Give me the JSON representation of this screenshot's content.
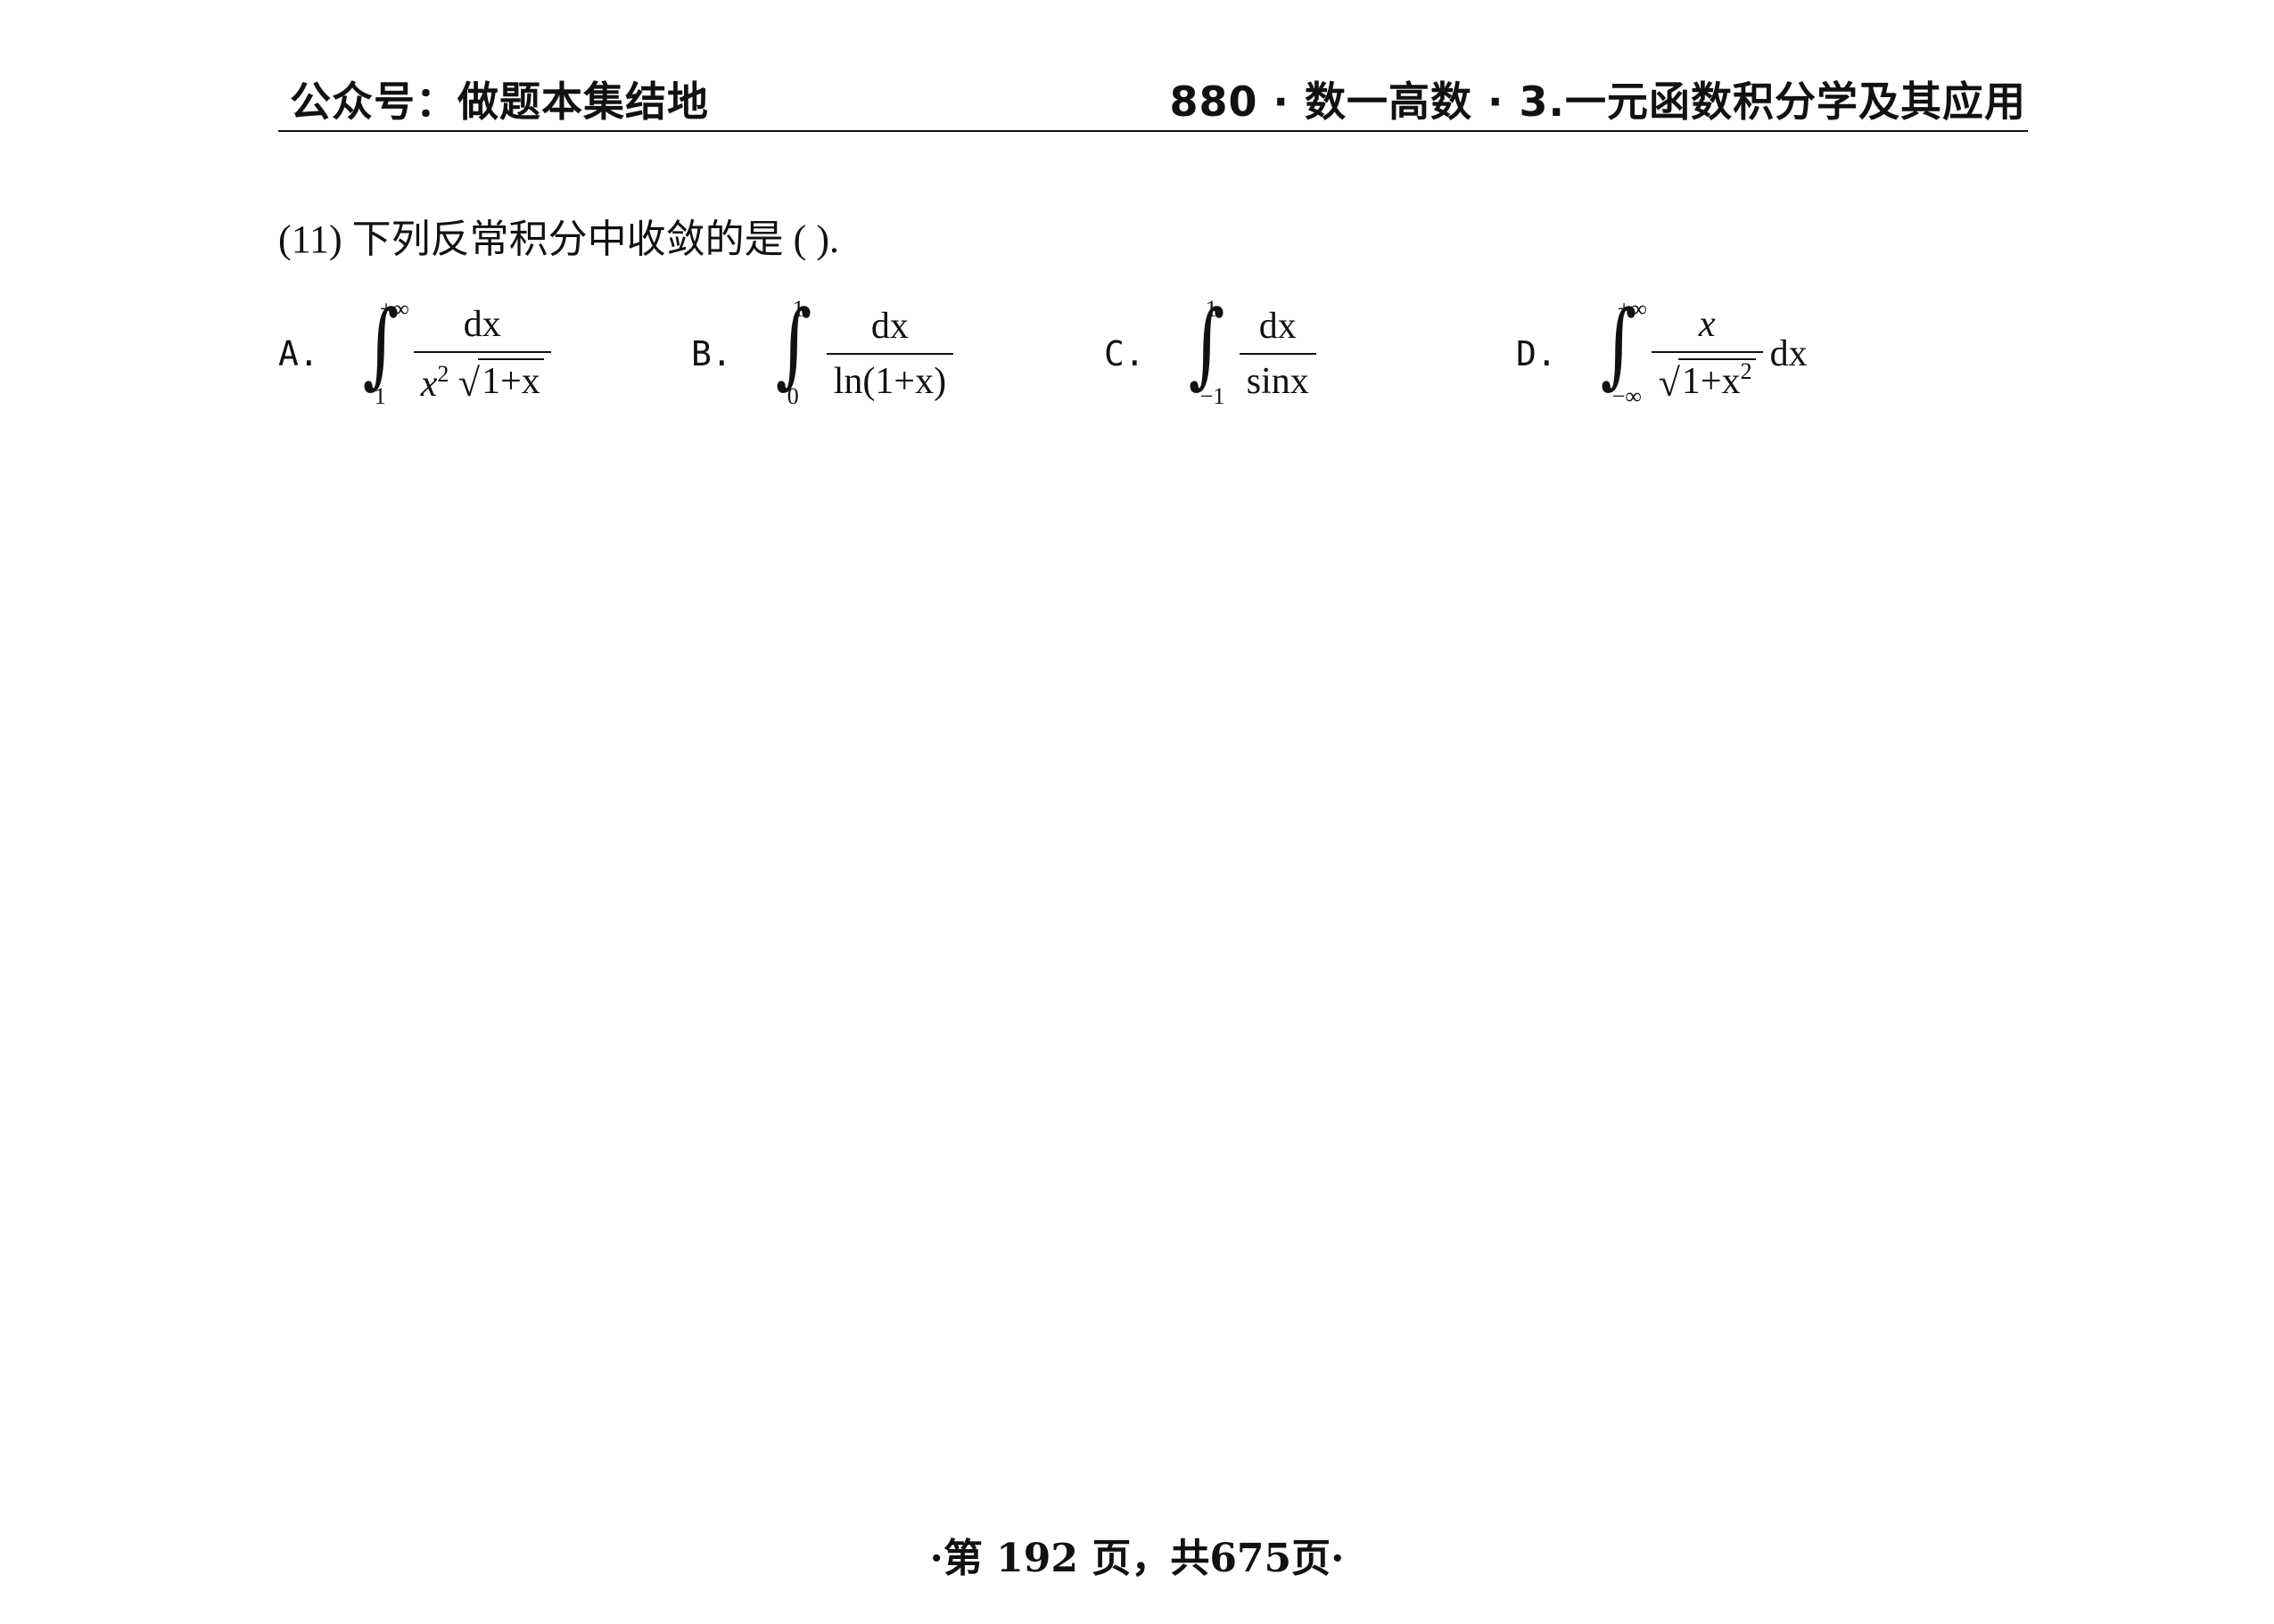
{
  "header": {
    "left": "公众号：做题本集结地",
    "right": "880 · 数一高数 · 3.一元函数积分学及其应用"
  },
  "question": {
    "text": "(11) 下列反常积分中收敛的是 (    )."
  },
  "options": {
    "a": {
      "label": "A.",
      "upper": "+∞",
      "lower": "1",
      "num": "dx",
      "den_pre": "x",
      "den_exp": "2",
      "den_rad": "1+x"
    },
    "b": {
      "label": "B.",
      "upper": "1",
      "lower": "0",
      "num": "dx",
      "den": "ln(1+x)"
    },
    "c": {
      "label": "C.",
      "upper": "1",
      "lower": "−1",
      "num": "dx",
      "den": "sinx"
    },
    "d": {
      "label": "D.",
      "upper": "+∞",
      "lower": "−∞",
      "num": "x",
      "den_rad": "1+x",
      "den_exp": "2",
      "after": "dx"
    }
  },
  "footer": {
    "text": "·第 192 页，共675页·"
  }
}
